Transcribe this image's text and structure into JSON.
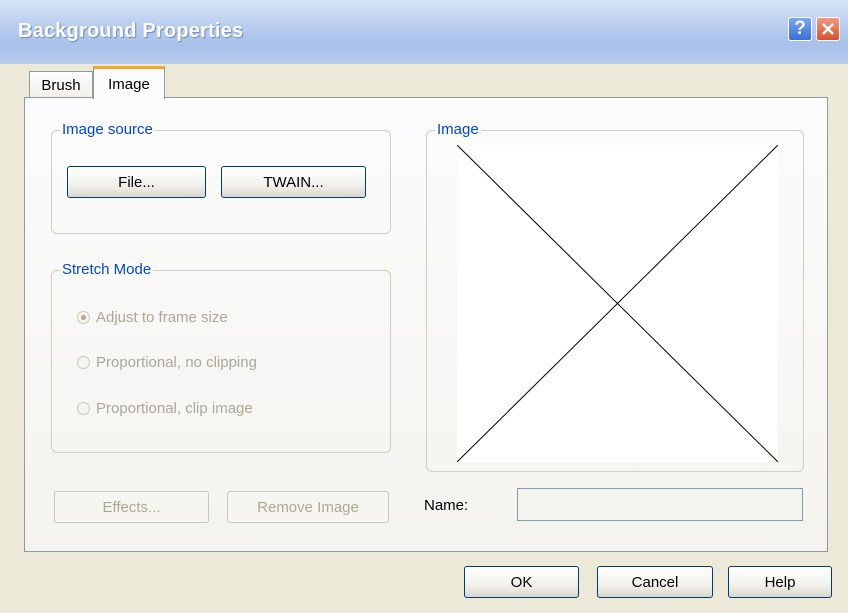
{
  "window": {
    "title": "Background Properties"
  },
  "tabs": [
    {
      "label": "Brush"
    },
    {
      "label": "Image"
    }
  ],
  "image_source": {
    "label": "Image source",
    "file_button": "File...",
    "twain_button": "TWAIN..."
  },
  "stretch_mode": {
    "label": "Stretch Mode",
    "options": [
      {
        "label": "Adjust to frame size",
        "selected": true
      },
      {
        "label": "Proportional, no clipping",
        "selected": false
      },
      {
        "label": "Proportional, clip image",
        "selected": false
      }
    ]
  },
  "image_group": {
    "label": "Image"
  },
  "actions": {
    "effects_button": "Effects...",
    "remove_image_button": "Remove Image"
  },
  "name": {
    "label": "Name:",
    "value": ""
  },
  "footer": {
    "ok": "OK",
    "cancel": "Cancel",
    "help": "Help"
  },
  "icons": {
    "help": "question-mark-icon",
    "close": "close-x-icon"
  },
  "colors": {
    "group_label": "#0046d5",
    "disabled_text": "#aca899",
    "tab_highlight": "#f4a82c"
  }
}
